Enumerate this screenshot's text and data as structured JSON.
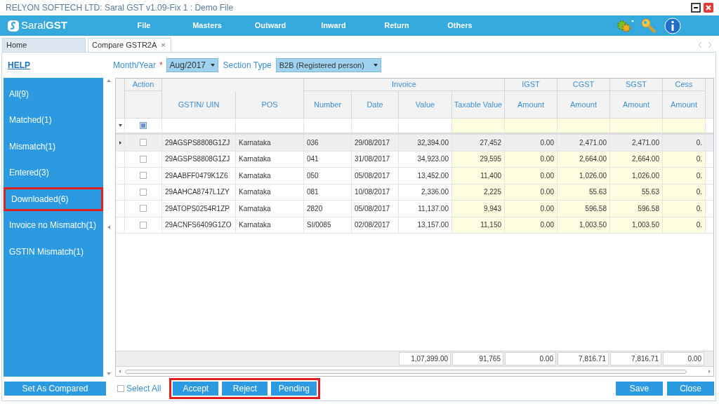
{
  "window": {
    "title": "RELYON SOFTECH LTD: Saral GST v1.09-Fix 1 : Demo File"
  },
  "logo": "Saral**GST**",
  "menu": [
    "File",
    "Masters",
    "Outward",
    "Inward",
    "Return",
    "Others"
  ],
  "tabs": [
    {
      "label": "Home",
      "selected": false
    },
    {
      "label": "Compare GSTR2A",
      "selected": true,
      "close": "×"
    }
  ],
  "help": "HELP",
  "month_year": {
    "label": "Month/Year",
    "required": "*",
    "value": "Aug/2017"
  },
  "section_type": {
    "label": "Section Type",
    "value": "B2B (Registered person)"
  },
  "sidebar": [
    {
      "label": "All(9)",
      "selected": false
    },
    {
      "label": "Matched(1)",
      "selected": false
    },
    {
      "label": "Mismatch(1)",
      "selected": false
    },
    {
      "label": "Entered(3)",
      "selected": false
    },
    {
      "label": "Downloaded(6)",
      "selected": true
    },
    {
      "label": "Invoice no Mismatch(1)",
      "selected": false
    },
    {
      "label": "GSTIN Mismatch(1)",
      "selected": false
    }
  ],
  "table": {
    "header_groups": [
      {
        "label": "Action"
      },
      {
        "columns": [
          "GSTIN/ UIN",
          "POS"
        ]
      },
      {
        "label": "Invoice",
        "columns": [
          "Number",
          "Date",
          "Value",
          "Taxable Value"
        ]
      },
      {
        "label": "IGST",
        "columns": [
          "Amount"
        ]
      },
      {
        "label": "CGST",
        "columns": [
          "Amount"
        ]
      },
      {
        "label": "SGST",
        "columns": [
          "Amount"
        ]
      },
      {
        "label": "Cess",
        "columns": [
          "Amount"
        ]
      }
    ],
    "filter_checkbox": {
      "indeterminate": true
    },
    "rows": [
      {
        "selected": true,
        "checked": false,
        "cells": [
          "29AGSPS8808G1ZJ",
          "Karnataka",
          "036",
          "29/08/2017",
          "32,394.00",
          "27,452",
          "0.00",
          "2,471.00",
          "2,471.00",
          "0."
        ]
      },
      {
        "selected": false,
        "checked": false,
        "cells": [
          "29AGSPS8808G1ZJ",
          "Karnataka",
          "041",
          "31/08/2017",
          "34,923.00",
          "29,595",
          "0.00",
          "2,664.00",
          "2,664.00",
          "0."
        ]
      },
      {
        "selected": false,
        "checked": false,
        "cells": [
          "29AABFF0479K1Z6",
          "Karnataka",
          "050",
          "05/08/2017",
          "13,452.00",
          "11,400",
          "0.00",
          "1,026.00",
          "1,026.00",
          "0."
        ]
      },
      {
        "selected": false,
        "checked": false,
        "cells": [
          "29AAHCA8747L1ZY",
          "Karnataka",
          "081",
          "10/08/2017",
          "2,336.00",
          "2,225",
          "0.00",
          "55.63",
          "55.63",
          "0."
        ]
      },
      {
        "selected": false,
        "checked": false,
        "cells": [
          "29ATOPS0254R1ZP",
          "Karnataka",
          "2820",
          "05/08/2017",
          "11,137.00",
          "9,943",
          "0.00",
          "596.58",
          "596.58",
          "0."
        ]
      },
      {
        "selected": false,
        "checked": false,
        "cells": [
          "29ACNFS6409G1ZO",
          "Karnataka",
          "SI/0085",
          "02/08/2017",
          "13,157.00",
          "11,150",
          "0.00",
          "1,003.50",
          "1,003.50",
          "0."
        ]
      }
    ],
    "totals": [
      "1,07,399.00",
      "91,765",
      "0.00",
      "7,816.71",
      "7,816.71",
      "0.00"
    ]
  },
  "set_as_compared": "Set As Compared",
  "select_all": {
    "label": "Select All",
    "checked": false
  },
  "actions": {
    "highlighted": true,
    "buttons": [
      "Accept",
      "Reject",
      "Pending"
    ]
  },
  "save": "Save",
  "close": "Close"
}
